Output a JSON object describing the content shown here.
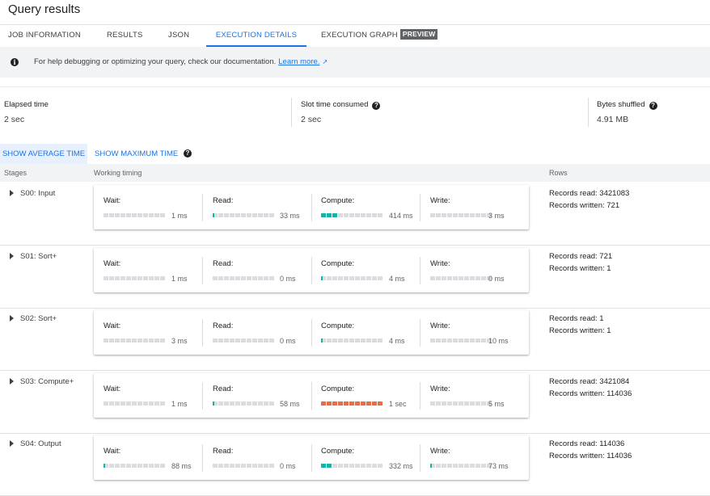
{
  "page_title": "Query results",
  "tabs": [
    {
      "label": "JOB INFORMATION"
    },
    {
      "label": "RESULTS"
    },
    {
      "label": "JSON"
    },
    {
      "label": "EXECUTION DETAILS",
      "active": true
    },
    {
      "label": "EXECUTION GRAPH",
      "badge": "PREVIEW"
    }
  ],
  "info_banner": {
    "text": "For help debugging or optimizing your query, check our documentation.",
    "link": "Learn more."
  },
  "stats": {
    "elapsed_label": "Elapsed time",
    "elapsed_value": "2 sec",
    "slot_label": "Slot time consumed",
    "slot_value": "2 sec",
    "bytes_label": "Bytes shuffled",
    "bytes_value": "4.91 MB"
  },
  "toggles": {
    "average": "SHOW AVERAGE TIME",
    "maximum": "SHOW MAXIMUM TIME"
  },
  "table_headers": {
    "stages": "Stages",
    "timing": "Working timing",
    "rows": "Rows"
  },
  "metric_labels": {
    "wait": "Wait:",
    "read": "Read:",
    "compute": "Compute:",
    "write": "Write:"
  },
  "colors": {
    "accent": "#1a73e8",
    "bar_empty": "#dadce0",
    "bar_normal": "#12b5a5",
    "bar_hot": "#f06a3a"
  },
  "stages": [
    {
      "name": "S00: Input",
      "wait": {
        "value": "1 ms",
        "fill": 0,
        "color": "teal"
      },
      "read": {
        "value": "33 ms",
        "fill": 0.5,
        "color": "teal"
      },
      "compute": {
        "value": "414 ms",
        "fill": 3,
        "color": "teal"
      },
      "write": {
        "value": "3 ms",
        "fill": 0,
        "color": "teal"
      },
      "rows_read": "Records read: 3421083",
      "rows_written": "Records written: 721"
    },
    {
      "name": "S01: Sort+",
      "wait": {
        "value": "1 ms",
        "fill": 0,
        "color": "teal"
      },
      "read": {
        "value": "0 ms",
        "fill": 0,
        "color": "teal"
      },
      "compute": {
        "value": "4 ms",
        "fill": 0.5,
        "color": "teal"
      },
      "write": {
        "value": "0 ms",
        "fill": 0,
        "color": "teal"
      },
      "rows_read": "Records read: 721",
      "rows_written": "Records written: 1"
    },
    {
      "name": "S02: Sort+",
      "wait": {
        "value": "3 ms",
        "fill": 0,
        "color": "teal"
      },
      "read": {
        "value": "0 ms",
        "fill": 0,
        "color": "teal"
      },
      "compute": {
        "value": "4 ms",
        "fill": 0.5,
        "color": "teal"
      },
      "write": {
        "value": "10 ms",
        "fill": 0,
        "color": "teal"
      },
      "rows_read": "Records read: 1",
      "rows_written": "Records written: 1"
    },
    {
      "name": "S03: Compute+",
      "wait": {
        "value": "1 ms",
        "fill": 0,
        "color": "teal"
      },
      "read": {
        "value": "58 ms",
        "fill": 0.5,
        "color": "teal"
      },
      "compute": {
        "value": "1 sec",
        "fill": 11,
        "color": "orange"
      },
      "write": {
        "value": "5 ms",
        "fill": 0,
        "color": "teal"
      },
      "rows_read": "Records read: 3421084",
      "rows_written": "Records written: 114036"
    },
    {
      "name": "S04: Output",
      "wait": {
        "value": "88 ms",
        "fill": 0.5,
        "color": "teal"
      },
      "read": {
        "value": "0 ms",
        "fill": 0,
        "color": "teal"
      },
      "compute": {
        "value": "332 ms",
        "fill": 2,
        "color": "teal"
      },
      "write": {
        "value": "73 ms",
        "fill": 0.5,
        "color": "teal"
      },
      "rows_read": "Records read: 114036",
      "rows_written": "Records written: 114036"
    }
  ]
}
